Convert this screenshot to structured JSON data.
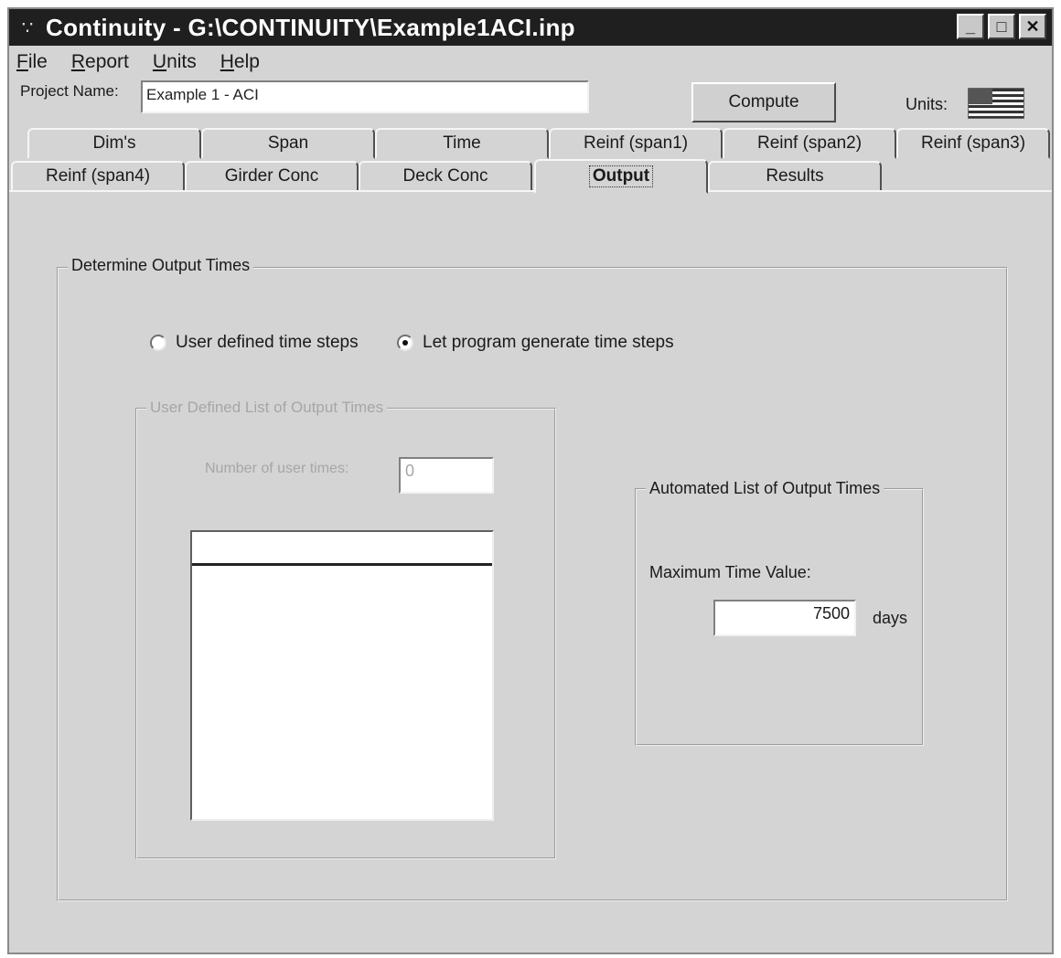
{
  "window": {
    "title": "Continuity - G:\\CONTINUITY\\Example1ACI.inp",
    "app_icon_glyph": "∵",
    "controls": {
      "minimize": "_",
      "maximize": "□",
      "close": "✕"
    }
  },
  "menu": [
    {
      "label": "File",
      "accel": "F",
      "rest": "ile"
    },
    {
      "label": "Report",
      "accel": "R",
      "rest": "eport"
    },
    {
      "label": "Units",
      "accel": "U",
      "rest": "nits"
    },
    {
      "label": "Help",
      "accel": "H",
      "rest": "elp"
    }
  ],
  "project": {
    "label": "Project Name:",
    "value": "Example 1 - ACI"
  },
  "compute_label": "Compute",
  "units_label": "Units:",
  "units_icon": "us-flag-icon",
  "tabs_row1": [
    "Dim's",
    "Span",
    "Time",
    "Reinf (span1)",
    "Reinf (span2)",
    "Reinf (span3)"
  ],
  "tabs_row2": [
    "Reinf (span4)",
    "Girder Conc",
    "Deck Conc",
    "Output",
    "Results"
  ],
  "active_tab": "Output",
  "output": {
    "group_title": "Determine Output Times",
    "radio_user": "User defined time steps",
    "radio_program": "Let program generate time steps",
    "selected": "program",
    "user_group_title": "User Defined List of Output Times",
    "num_user_times_label": "Number of user times:",
    "num_user_times_value": "0",
    "auto_group_title": "Automated List of Output Times",
    "max_time_label": "Maximum Time Value:",
    "max_time_value": "7500",
    "max_time_unit": "days"
  }
}
